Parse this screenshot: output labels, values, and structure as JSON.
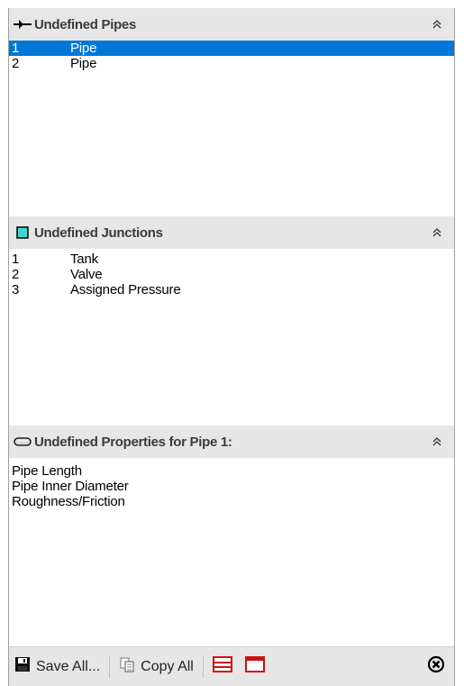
{
  "pipes_panel": {
    "title": "Undefined Pipes",
    "items": [
      {
        "num": "1",
        "type": "Pipe",
        "selected": true
      },
      {
        "num": "2",
        "type": "Pipe",
        "selected": false
      }
    ]
  },
  "junctions_panel": {
    "title": "Undefined Junctions",
    "items": [
      {
        "num": "1",
        "type": "Tank"
      },
      {
        "num": "2",
        "type": "Valve"
      },
      {
        "num": "3",
        "type": "Assigned Pressure"
      }
    ]
  },
  "properties_panel": {
    "title": "Undefined Properties for Pipe 1:",
    "items": [
      "Pipe Length",
      "Pipe Inner Diameter",
      "Roughness/Friction"
    ]
  },
  "toolbar": {
    "save_all_label": "Save All...",
    "copy_all_label": "Copy All"
  },
  "colors": {
    "selection": "#0078d7",
    "header_bg": "#e6e6e6",
    "junction_icon": "#3dd6d6",
    "bar_icon_red": "#cc1111"
  },
  "icons": {
    "pipes": "pipe-arrow-icon",
    "junctions": "junction-square-icon",
    "properties": "property-capsule-icon",
    "collapse": "double-chevron-up-icon",
    "save": "floppy-disk-icon",
    "copy": "copy-document-icon",
    "expand_all": "stacked-lines-icon",
    "collapse_all": "window-frame-icon",
    "close": "circle-close-icon"
  }
}
